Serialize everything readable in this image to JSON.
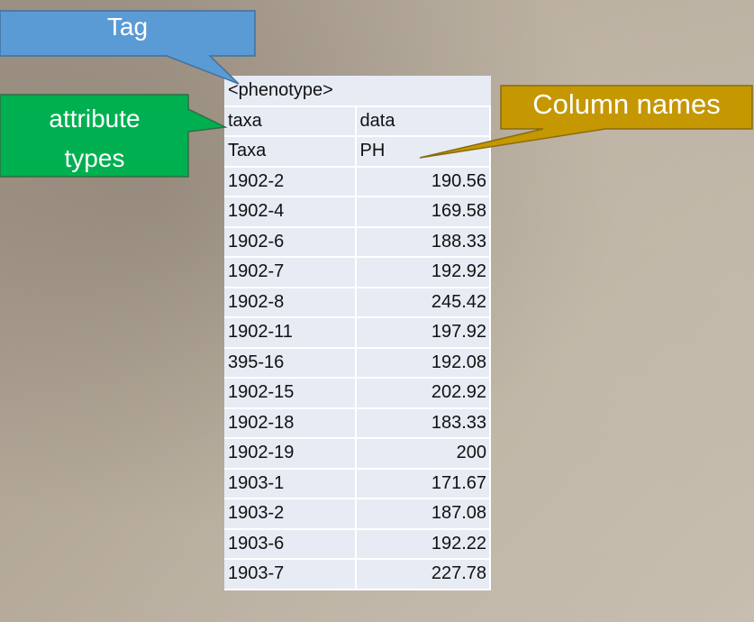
{
  "callouts": {
    "tag": {
      "label": "Tag",
      "color": "#5b9bd5"
    },
    "attribute_types": {
      "line1": "attribute",
      "line2": "types",
      "color": "#00b050"
    },
    "column_names": {
      "label": "Column names",
      "color": "#c59700"
    }
  },
  "table": {
    "tag": "<phenotype>",
    "attribute_types": [
      "taxa",
      "data"
    ],
    "column_names": [
      "Taxa",
      "PH"
    ],
    "rows": [
      [
        "1902-2",
        "190.56"
      ],
      [
        "1902-4",
        "169.58"
      ],
      [
        "1902-6",
        "188.33"
      ],
      [
        "1902-7",
        "192.92"
      ],
      [
        "1902-8",
        "245.42"
      ],
      [
        "1902-11",
        "197.92"
      ],
      [
        "395-16",
        "192.08"
      ],
      [
        "1902-15",
        "202.92"
      ],
      [
        "1902-18",
        "183.33"
      ],
      [
        "1902-19",
        "200"
      ],
      [
        "1903-1",
        "171.67"
      ],
      [
        "1903-2",
        "187.08"
      ],
      [
        "1903-6",
        "192.22"
      ],
      [
        "1903-7",
        "227.78"
      ]
    ]
  }
}
